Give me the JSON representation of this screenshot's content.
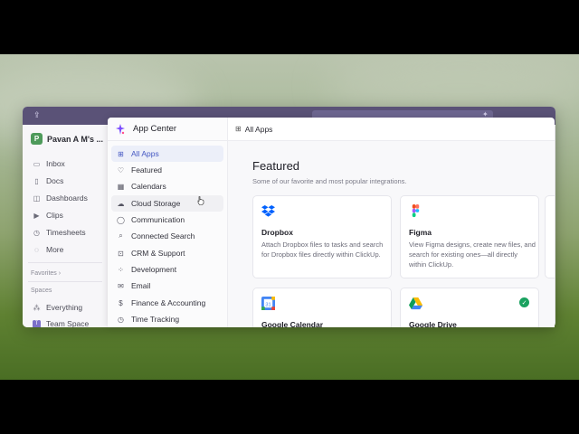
{
  "sidebar": {
    "workspace_initial": "P",
    "workspace_name": "Pavan A M's ...",
    "items": [
      {
        "label": "Inbox",
        "icon": "inbox-icon"
      },
      {
        "label": "Docs",
        "icon": "doc-icon"
      },
      {
        "label": "Dashboards",
        "icon": "dashboard-icon"
      },
      {
        "label": "Clips",
        "icon": "video-icon"
      },
      {
        "label": "Timesheets",
        "icon": "clock-icon"
      },
      {
        "label": "More",
        "icon": "more-icon"
      }
    ],
    "favorites_label": "Favorites ›",
    "spaces_label": "Spaces",
    "spaces": [
      {
        "label": "Everything",
        "icon": "grid-icon"
      },
      {
        "label": "Team Space",
        "icon": "team-icon"
      }
    ]
  },
  "modal": {
    "title": "App Center",
    "categories": [
      {
        "label": "All Apps",
        "icon": "grid-icon",
        "active": true
      },
      {
        "label": "Featured",
        "icon": "heart-icon"
      },
      {
        "label": "Calendars",
        "icon": "calendar-icon"
      },
      {
        "label": "Cloud Storage",
        "icon": "cloud-icon",
        "hover": true
      },
      {
        "label": "Communication",
        "icon": "chat-icon"
      },
      {
        "label": "Connected Search",
        "icon": "search-icon"
      },
      {
        "label": "CRM & Support",
        "icon": "cart-icon"
      },
      {
        "label": "Development",
        "icon": "code-icon"
      },
      {
        "label": "Email",
        "icon": "mail-icon"
      },
      {
        "label": "Finance & Accounting",
        "icon": "dollar-icon"
      },
      {
        "label": "Time Tracking",
        "icon": "clock-icon"
      }
    ],
    "breadcrumb": "All Apps",
    "featured_title": "Featured",
    "featured_subtitle": "Some of our favorite and most popular integrations.",
    "cards": [
      {
        "name": "Dropbox",
        "desc": "Attach Dropbox files to tasks and search for Dropbox files directly within ClickUp.",
        "logo": "dropbox-logo"
      },
      {
        "name": "Figma",
        "desc": "View Figma designs, create new files, and search for existing ones—all directly within ClickUp.",
        "logo": "figma-logo"
      },
      {
        "name": "Google Calendar",
        "desc": "",
        "logo": "google-calendar-logo"
      },
      {
        "name": "Google Drive",
        "desc": "",
        "logo": "google-drive-logo",
        "installed": true
      }
    ]
  },
  "colors": {
    "topbar": "#5a5277",
    "accent": "#4457c2",
    "installed": "#1aa260"
  }
}
